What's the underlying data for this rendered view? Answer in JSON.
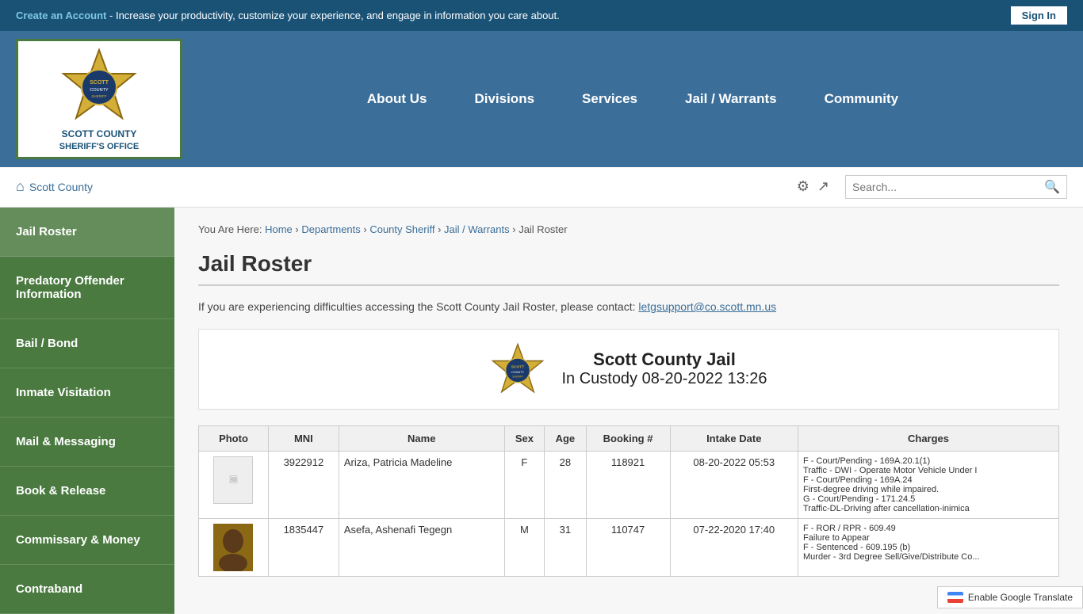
{
  "topbar": {
    "create_account_label": "Create an Account",
    "tagline": " - Increase your productivity, customize your experience, and engage in information you care about.",
    "signin_label": "Sign In"
  },
  "header": {
    "logo_line1": "SCOTT COUNTY",
    "logo_line2": "SHERIFF'S OFFICE",
    "nav": [
      {
        "id": "about-us",
        "label": "About Us"
      },
      {
        "id": "divisions",
        "label": "Divisions"
      },
      {
        "id": "services",
        "label": "Services"
      },
      {
        "id": "jail-warrants",
        "label": "Jail / Warrants"
      },
      {
        "id": "community",
        "label": "Community"
      }
    ]
  },
  "subheader": {
    "home_label": "Scott County",
    "search_placeholder": "Search..."
  },
  "breadcrumb": {
    "you_are_here": "You Are Here:",
    "items": [
      {
        "label": "Home",
        "href": "#"
      },
      {
        "label": "Departments",
        "href": "#"
      },
      {
        "label": "County Sheriff",
        "href": "#"
      },
      {
        "label": "Jail / Warrants",
        "href": "#"
      },
      {
        "label": "Jail Roster",
        "href": "#"
      }
    ]
  },
  "sidebar": {
    "items": [
      {
        "id": "jail-roster",
        "label": "Jail Roster",
        "active": true
      },
      {
        "id": "predatory-offender",
        "label": "Predatory Offender Information",
        "active": false
      },
      {
        "id": "bail-bond",
        "label": "Bail / Bond",
        "active": false
      },
      {
        "id": "inmate-visitation",
        "label": "Inmate Visitation",
        "active": false
      },
      {
        "id": "mail-messaging",
        "label": "Mail & Messaging",
        "active": false
      },
      {
        "id": "book-release",
        "label": "Book & Release",
        "active": false
      },
      {
        "id": "commissary-money",
        "label": "Commissary & Money",
        "active": false
      },
      {
        "id": "contraband",
        "label": "Contraband",
        "active": false
      }
    ]
  },
  "main": {
    "page_title": "Jail Roster",
    "notice": "If you are experiencing difficulties accessing the Scott County Jail Roster, please contact: ",
    "contact_email": "letgsupport@co.scott.mn.us",
    "roster_title_line1": "Scott County Jail",
    "roster_title_line2": "In Custody 08-20-2022 13:26",
    "table_headers": [
      "Photo",
      "MNI",
      "Name",
      "Sex",
      "Age",
      "Booking #",
      "Intake Date",
      "Charges"
    ],
    "table_rows": [
      {
        "photo": "placeholder",
        "mni": "3922912",
        "name": "Ariza, Patricia Madeline",
        "sex": "F",
        "age": "28",
        "booking": "118921",
        "intake_date": "08-20-2022 05:53",
        "charges": "F  -  Court/Pending       -  169A.20.1(1)\nTraffic - DWI - Operate Motor Vehicle Under I\nF  -  Court/Pending       -  169A.24\nFirst-degree driving while impaired.\nG  -  Court/Pending       -  171.24.5\nTraffic-DL-Driving after cancellation-inimica"
      },
      {
        "photo": "actual",
        "mni": "1835447",
        "name": "Asefa, Ashenafi Tegegn",
        "sex": "M",
        "age": "31",
        "booking": "110747",
        "intake_date": "07-22-2020 17:40",
        "charges": "F  -  ROR / RPR            -  609.49\nFailure to Appear\nF  -  Sentenced           -  609.195 (b)\nMurder - 3rd Degree  Sell/Give/Distribute Co..."
      }
    ]
  },
  "footer": {
    "translate_label": "Enable Google Translate"
  }
}
